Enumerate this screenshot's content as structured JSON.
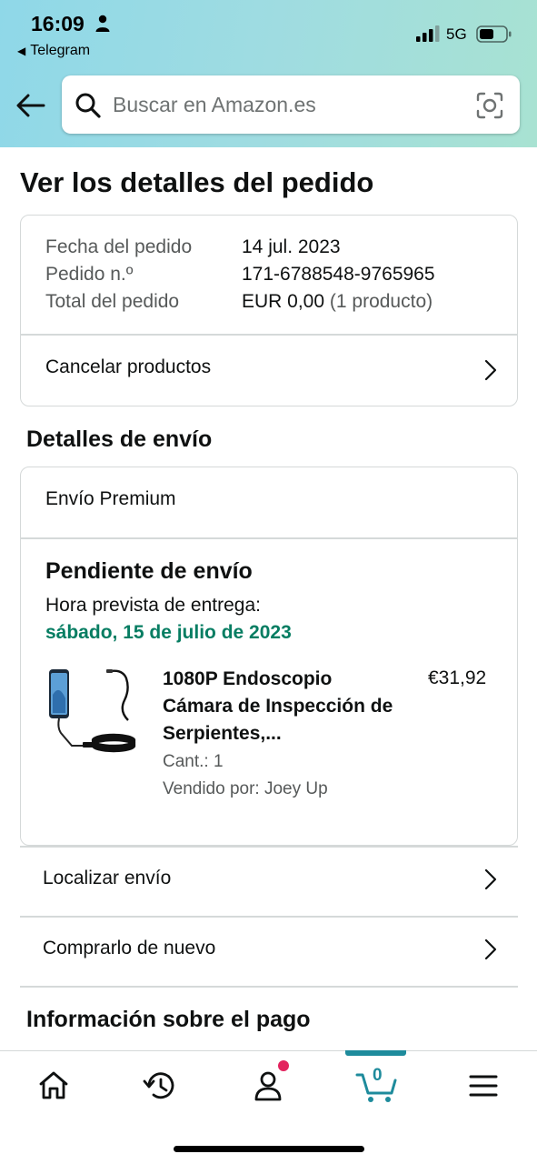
{
  "status_bar": {
    "time": "16:09",
    "back_app": "Telegram",
    "network": "5G"
  },
  "search": {
    "placeholder": "Buscar en Amazon.es"
  },
  "page": {
    "title": "Ver los detalles del pedido"
  },
  "order": {
    "date_label": "Fecha del pedido",
    "date_value": "14 jul. 2023",
    "number_label": "Pedido n.º",
    "number_value": "171-6788548-9765965",
    "total_label": "Total del pedido",
    "total_value": "EUR 0,00",
    "total_count": "(1 producto)",
    "cancel_label": "Cancelar productos"
  },
  "shipping": {
    "section_title": "Detalles de envío",
    "method": "Envío Premium",
    "status": "Pendiente de envío",
    "eta_label": "Hora prevista de entrega:",
    "eta_date": "sábado, 15 de julio de 2023",
    "product": {
      "title": "1080P Endoscopio Cámara de Inspección de Serpientes,...",
      "price": "€31,92",
      "qty": "Cant.: 1",
      "seller": "Vendido por: Joey Up"
    },
    "track_label": "Localizar envío",
    "buy_again_label": "Comprarlo de nuevo"
  },
  "payment": {
    "section_title": "Información sobre el pago"
  },
  "bottom_nav": {
    "cart_count": "0",
    "items": [
      "home-icon",
      "history-icon",
      "account-icon",
      "cart-icon",
      "menu-icon"
    ]
  },
  "colors": {
    "header_gradient_start": "#8fd8e8",
    "header_gradient_end": "#a8e2d2",
    "eta_green": "#067d62",
    "accent_teal": "#1e8b9c",
    "notification_pink": "#e3245e"
  }
}
